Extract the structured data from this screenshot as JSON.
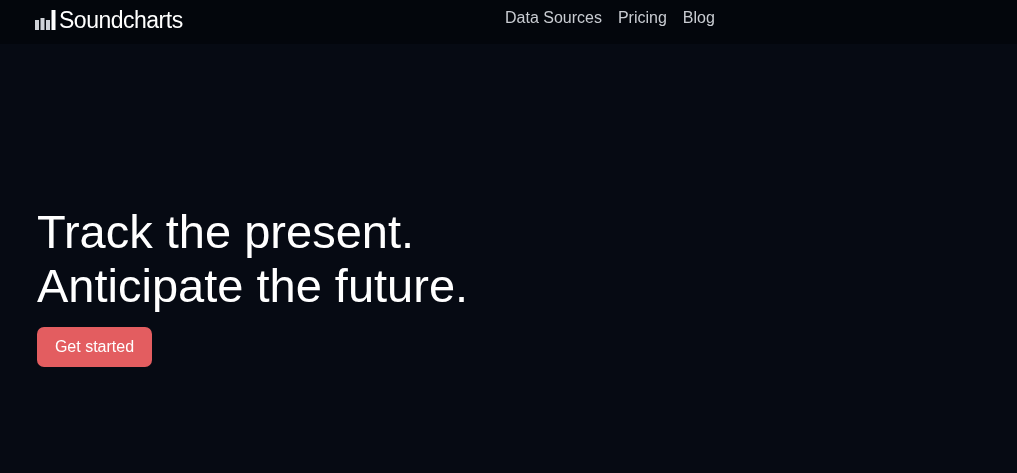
{
  "header": {
    "logo": "Soundcharts",
    "nav": [
      {
        "label": "Data Sources"
      },
      {
        "label": "Pricing"
      },
      {
        "label": "Blog"
      }
    ]
  },
  "hero": {
    "headline_lines": [
      "Track the present.",
      "Anticipate the future."
    ],
    "cta": "Get started"
  }
}
